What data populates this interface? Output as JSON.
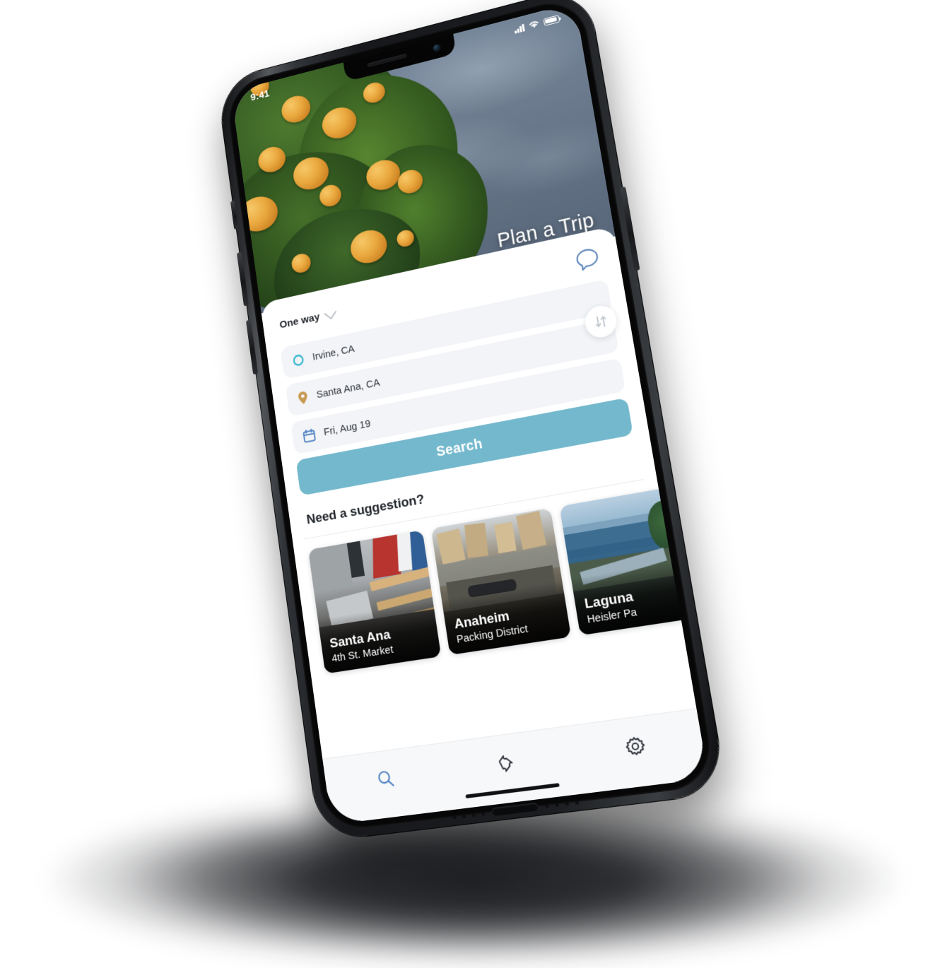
{
  "device": {
    "name": "smartphone-mockup"
  },
  "status_bar": {
    "time": "9:41",
    "icons": [
      "cellular-signal-icon",
      "wifi-icon",
      "battery-icon"
    ]
  },
  "hero": {
    "title": "Plan a Trip",
    "image_description": "orange citrus tree against blue-grey sky",
    "sky_color": "#6d7d8f"
  },
  "form": {
    "trip_type": "One way",
    "trip_type_icon": "chevron-down-icon",
    "chat_icon": "chat-bubble-icon",
    "fields": [
      {
        "icon": "origin-circle-icon",
        "icon_color": "#35b6cf",
        "value": "Irvine, CA"
      },
      {
        "icon": "destination-pin-icon",
        "icon_color": "#c79a52",
        "value": "Santa Ana, CA"
      },
      {
        "icon": "calendar-icon",
        "icon_color": "#4f83c4",
        "value": "Fri, Aug 19"
      }
    ],
    "swap_icon": "swap-vertical-icon",
    "search_label": "Search",
    "search_color": "#74b8cd"
  },
  "suggestions": {
    "heading": "Need a suggestion?",
    "cards": [
      {
        "title": "Santa Ana",
        "subtitle": "4th St. Market"
      },
      {
        "title": "Anaheim",
        "subtitle": "Packing District"
      },
      {
        "title": "Laguna",
        "subtitle": "Heisler Pa"
      }
    ]
  },
  "tab_bar": {
    "tabs": [
      {
        "name": "search-tab",
        "icon": "magnifier-icon",
        "active": true,
        "color": "#4f83c4"
      },
      {
        "name": "tickets-tab",
        "icon": "ticket-icon",
        "active": false,
        "color": "#2b2f36"
      },
      {
        "name": "settings-tab",
        "icon": "gear-icon",
        "active": false,
        "color": "#2b2f36"
      }
    ]
  }
}
